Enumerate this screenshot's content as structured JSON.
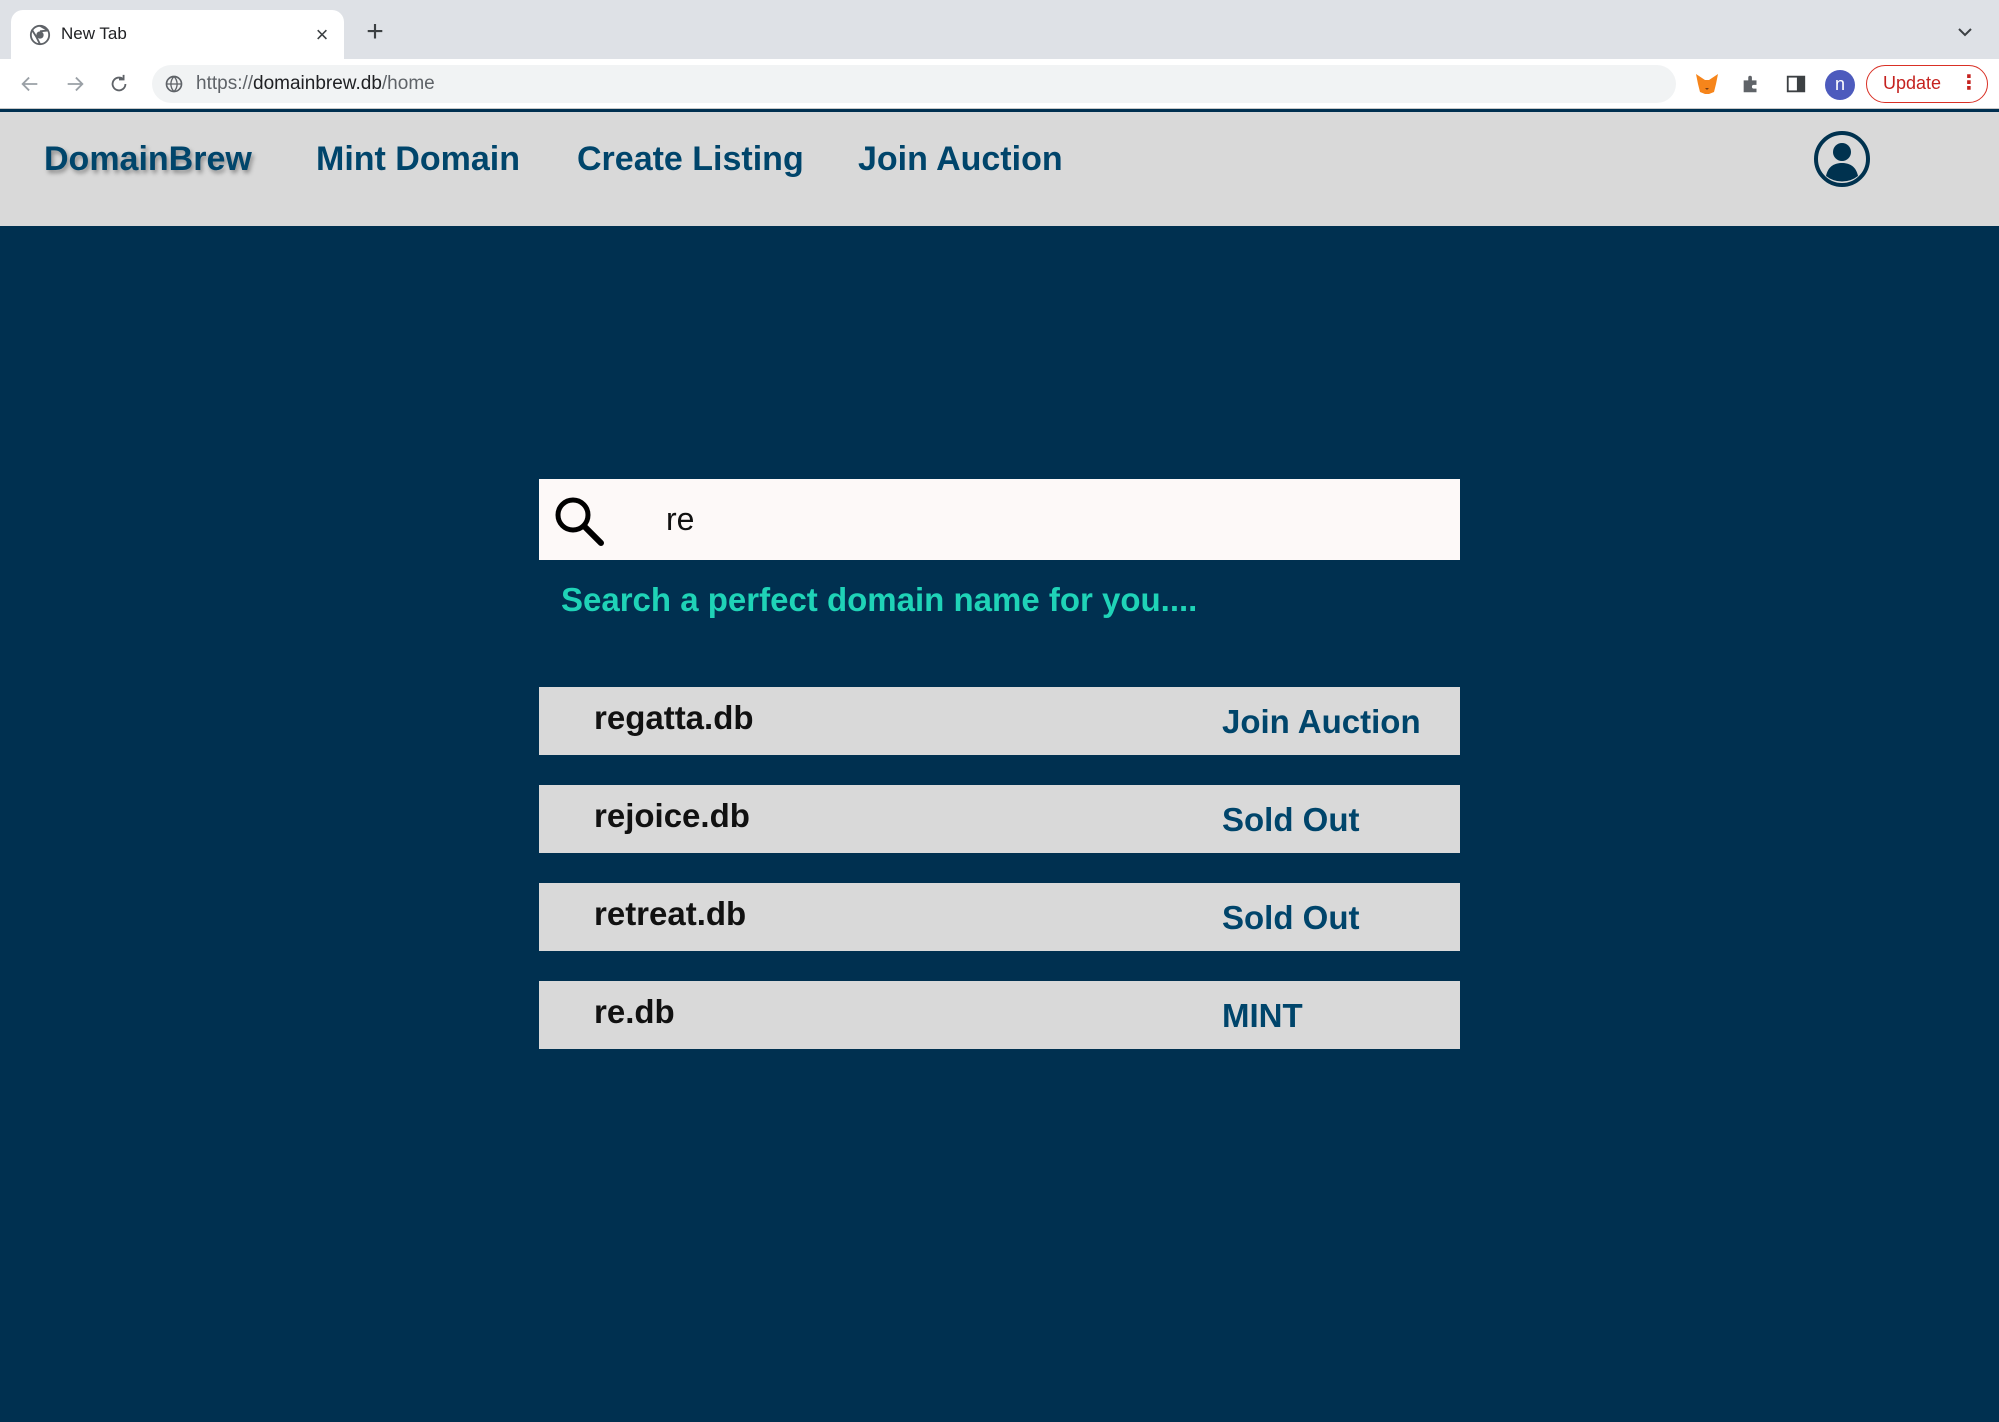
{
  "browser": {
    "tab_title": "New Tab",
    "url_scheme": "https://",
    "url_host": "domainbrew.db",
    "url_path": "/home",
    "profile_initial": "n",
    "update_label": "Update"
  },
  "header": {
    "brand": "DomainBrew",
    "nav": [
      "Mint Domain",
      "Create Listing",
      "Join Auction"
    ]
  },
  "search": {
    "value": "re",
    "hint": "Search a perfect domain name for you...."
  },
  "results": [
    {
      "name": "regatta.db",
      "action": "Join Auction"
    },
    {
      "name": "rejoice.db",
      "action": "Sold Out"
    },
    {
      "name": "retreat.db",
      "action": "Sold Out"
    },
    {
      "name": "re.db",
      "action": "MINT"
    }
  ],
  "colors": {
    "page_bg": "#003050",
    "header_bg": "#d9d9d9",
    "accent": "#00456b",
    "hint": "#1fd3b7"
  }
}
